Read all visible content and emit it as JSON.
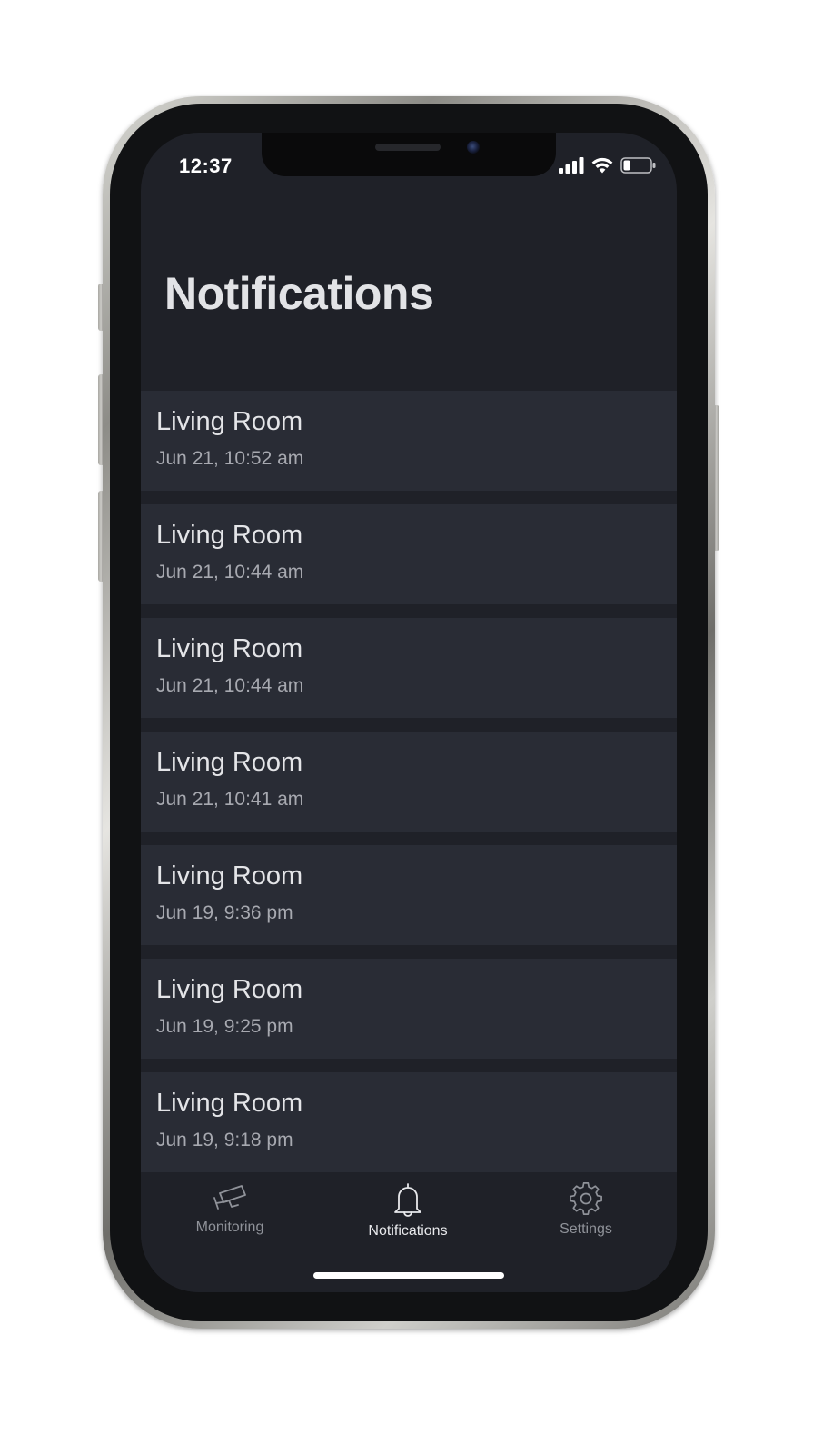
{
  "status_bar": {
    "time": "12:37",
    "icons": [
      "signal-icon",
      "wifi-icon",
      "battery-icon"
    ]
  },
  "header": {
    "title": "Notifications"
  },
  "notifications": [
    {
      "title": "Living Room",
      "time": "Jun 21, 10:52 am"
    },
    {
      "title": "Living Room",
      "time": "Jun 21, 10:44 am"
    },
    {
      "title": "Living Room",
      "time": "Jun 21, 10:44 am"
    },
    {
      "title": "Living Room",
      "time": "Jun 21, 10:41 am"
    },
    {
      "title": "Living Room",
      "time": "Jun 19, 9:36 pm"
    },
    {
      "title": "Living Room",
      "time": "Jun 19, 9:25 pm"
    },
    {
      "title": "Living Room",
      "time": "Jun 19, 9:18 pm"
    }
  ],
  "tab_bar": {
    "tabs": [
      {
        "label": "Monitoring",
        "icon": "camera-icon",
        "active": false
      },
      {
        "label": "Notifications",
        "icon": "bell-icon",
        "active": true
      },
      {
        "label": "Settings",
        "icon": "gear-icon",
        "active": false
      }
    ]
  },
  "colors": {
    "background": "#1f2128",
    "card": "#292c35",
    "title_text": "#e2e3e6",
    "secondary_text": "#a7a9b0",
    "inactive_tab": "#8f9299"
  }
}
